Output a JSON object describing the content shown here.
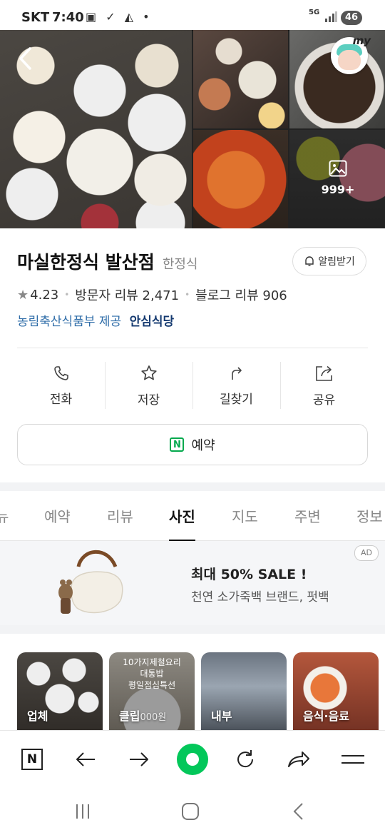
{
  "status_bar": {
    "carrier": "SKT",
    "time": "7:40",
    "network": "5G",
    "battery": "46",
    "icons": [
      "screenshot-icon",
      "app-icon",
      "app-icon",
      "dot-icon"
    ]
  },
  "hero": {
    "more_photos_count": "999+"
  },
  "place": {
    "name": "마실한정식 발산점",
    "category": "한정식",
    "alarm_label": "알림받기",
    "rating": "4.23",
    "visitor_reviews": "방문자 리뷰 2,471",
    "blog_reviews": "블로그 리뷰 906",
    "provider": "농림축산식품부 제공",
    "safe_label": "안심식당"
  },
  "actions": [
    {
      "label": "전화",
      "icon": "phone-icon"
    },
    {
      "label": "저장",
      "icon": "star-icon"
    },
    {
      "label": "길찾기",
      "icon": "directions-icon"
    },
    {
      "label": "공유",
      "icon": "share-icon"
    }
  ],
  "reserve": {
    "label": "예약",
    "icon_letter": "N"
  },
  "tabs": [
    {
      "label": "뉴"
    },
    {
      "label": "예약"
    },
    {
      "label": "리뷰"
    },
    {
      "label": "사진",
      "active": true
    },
    {
      "label": "지도"
    },
    {
      "label": "주변"
    },
    {
      "label": "정보"
    }
  ],
  "ad": {
    "badge": "AD",
    "title": "최대 50% SALE !",
    "subtitle": "천연 소가죽백 브랜드, 펏백"
  },
  "thumbnails": [
    {
      "label": "업체"
    },
    {
      "label": "클립",
      "overlay_text": [
        "10가지제철요리",
        "대통밥",
        "평일점심특선"
      ],
      "price": "000원"
    },
    {
      "label": "내부"
    },
    {
      "label": "음식·음료"
    }
  ],
  "browser_toolbar": {
    "logo_letter": "N"
  },
  "colors": {
    "accent_green": "#03c75a",
    "link_blue": "#2e6ca8",
    "naver_green": "#03a94d"
  }
}
